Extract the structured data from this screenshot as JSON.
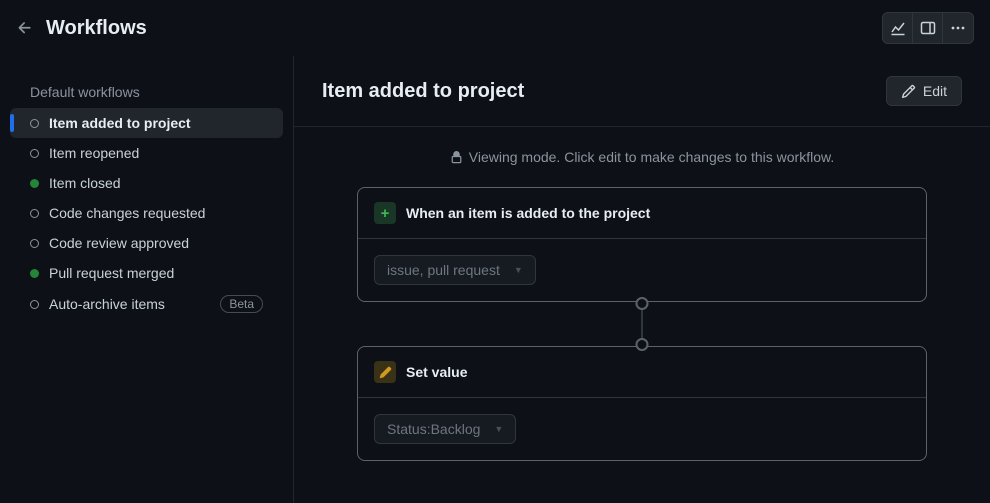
{
  "header": {
    "title": "Workflows"
  },
  "sidebar": {
    "section_label": "Default workflows",
    "items": [
      {
        "label": "Item added to project",
        "status": "off",
        "active": true
      },
      {
        "label": "Item reopened",
        "status": "off",
        "active": false
      },
      {
        "label": "Item closed",
        "status": "on",
        "active": false
      },
      {
        "label": "Code changes requested",
        "status": "off",
        "active": false
      },
      {
        "label": "Code review approved",
        "status": "off",
        "active": false
      },
      {
        "label": "Pull request merged",
        "status": "on",
        "active": false
      },
      {
        "label": "Auto-archive items",
        "status": "off",
        "active": false,
        "badge": "Beta"
      }
    ]
  },
  "main": {
    "title": "Item added to project",
    "edit_label": "Edit",
    "viewing_mode_text": "Viewing mode. Click edit to make changes to this workflow.",
    "trigger": {
      "title": "When an item is added to the project",
      "pill": "issue, pull request"
    },
    "action": {
      "title": "Set value",
      "pill": "Status:Backlog"
    }
  }
}
